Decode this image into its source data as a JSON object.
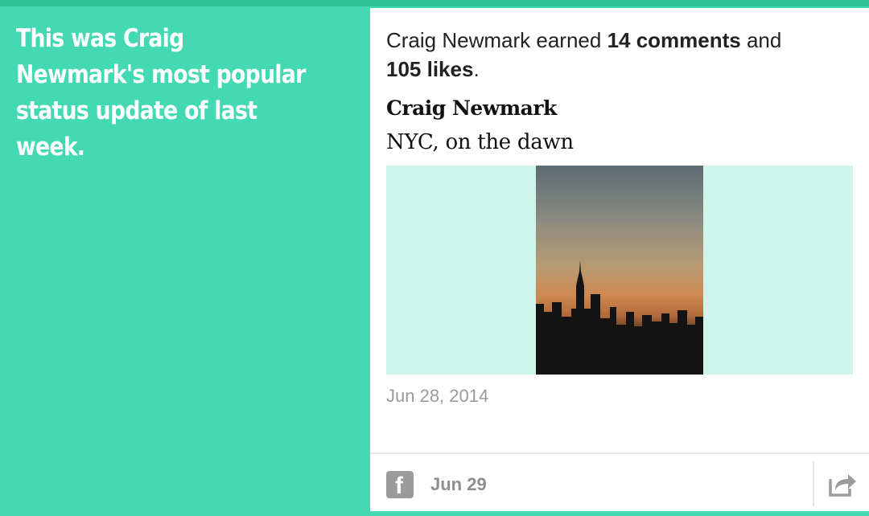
{
  "left": {
    "headline": "This was Craig Newmark's most popular status update of last week."
  },
  "summary": {
    "prefix": "Craig Newmark earned ",
    "comments": "14 comments",
    "middle": " and",
    "likes": "105 likes",
    "suffix": "."
  },
  "post": {
    "author": "Craig Newmark",
    "text": "NYC, on the dawn",
    "date": "Jun 28, 2014",
    "image": "nyc-skyline-dawn-photo"
  },
  "footer": {
    "network_icon": "facebook-icon",
    "date": "Jun 29",
    "share_icon": "share-icon"
  },
  "colors": {
    "accent": "#43dab3",
    "accent_dark": "#2bc193",
    "image_bg": "#cff4ea"
  }
}
